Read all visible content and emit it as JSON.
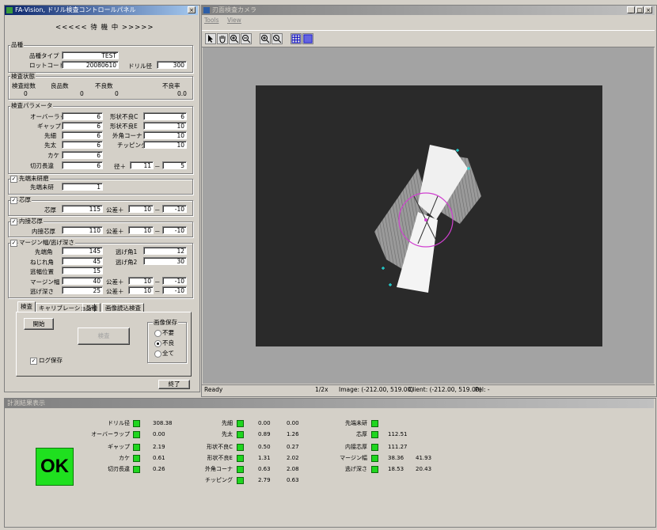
{
  "control_panel": {
    "title": "FA-Vision, ドリル検査コントロールパネル",
    "status": "<<<<< 待 機 中 >>>>>",
    "product": {
      "group": "品種",
      "type_label": "品種タイプ",
      "type_value": "TEST",
      "lot_label": "ロットコード",
      "lot_value": "20080610",
      "diameter_label": "ドリル径",
      "diameter_value": "300"
    },
    "inspection_status": {
      "group": "検査状態",
      "headers": [
        "検査総数",
        "良品数",
        "不良数",
        "不良率"
      ],
      "values": [
        "0",
        "0",
        "0",
        "0.0"
      ]
    },
    "params": {
      "group": "検査パラメータ",
      "left": [
        {
          "label": "オーバーラップ",
          "value": "6"
        },
        {
          "label": "ギャップ",
          "value": "6"
        },
        {
          "label": "先細",
          "value": "6"
        },
        {
          "label": "先太",
          "value": "6"
        },
        {
          "label": "カケ",
          "value": "6"
        },
        {
          "label": "切刃長違",
          "value": "6"
        }
      ],
      "right": [
        {
          "label": "形状不良C",
          "value": "6"
        },
        {
          "label": "形状不良E",
          "value": "10"
        },
        {
          "label": "外角コーナ",
          "value": "10"
        },
        {
          "label": "チッピング",
          "value": "10"
        }
      ],
      "diameter_tol_label": "径＋",
      "diameter_tol_plus": "11",
      "diameter_tol_dash": "－",
      "diameter_tol_minus": "5"
    },
    "tip_unpolished": {
      "group": "先端未研磨",
      "checked": true,
      "label": "先端未研",
      "value": "1"
    },
    "core_thickness": {
      "group": "芯厚",
      "checked": true,
      "label": "芯厚",
      "value": "115",
      "tol_label": "公差＋",
      "tol_plus": "10",
      "tol_dash": "－",
      "tol_minus": "-10"
    },
    "inner_core": {
      "group": "内接芯厚",
      "checked": true,
      "label": "内接芯厚",
      "value": "110",
      "tol_label": "公差＋",
      "tol_plus": "10",
      "tol_dash": "－",
      "tol_minus": "-10"
    },
    "margin": {
      "group": "マージン幅/逃げ深さ",
      "checked": true,
      "tip_angle_label": "先端角",
      "tip_angle": "145",
      "twist_label": "ねじれ角",
      "twist": "45",
      "margin_pos_label": "逃幅位置",
      "margin_pos": "15",
      "margin_width_label": "マージン幅",
      "margin_width": "40",
      "relief_depth_label": "逃げ深さ",
      "relief_depth": "25",
      "relief1_label": "逃げ角1",
      "relief1": "12",
      "relief2_label": "逃げ角2",
      "relief2": "30",
      "tol_label": "公差＋",
      "mw_tol_plus": "10",
      "mw_tol_minus": "-10",
      "rd_tol_plus": "10",
      "rd_tol_minus": "-10",
      "tol_dash": "－"
    },
    "tabs": [
      "検査",
      "キャリブレーション",
      "品種",
      "画像読込検査"
    ],
    "start_button": "開始",
    "inspect_button": "検査",
    "image_save": {
      "group": "画像保存",
      "options": [
        "不要",
        "不良",
        "全て"
      ],
      "selected": "不良"
    },
    "log_save_label": "ログ保存",
    "log_save_checked": true,
    "exit_button": "終了"
  },
  "camera_window": {
    "title": "刃面検査カメラ",
    "menu": [
      "Tools",
      "View"
    ],
    "toolbar_icons": [
      "pointer-icon",
      "hand-icon",
      "zoom-in-icon",
      "zoom-out-icon",
      "zoom-in-2-icon",
      "zoom-fit-icon",
      "grid-icon",
      "grid-dense-icon"
    ],
    "status_ready": "Ready",
    "status_zoom": "1/2x",
    "status_image": "Image: (-212.00, 519.00)",
    "status_client": "Client: (-212.00, 519.00)",
    "status_pel": "Pel: -"
  },
  "results": {
    "title": "計測結果表示",
    "verdict": "OK",
    "verdict_color": "#1fe01f",
    "led_color": "#1fd61f",
    "col1": [
      {
        "label": "ドリル径",
        "v1": "308.38"
      },
      {
        "label": "オーバーラップ",
        "v1": "0.00"
      },
      {
        "label": "ギャップ",
        "v1": "2.19"
      },
      {
        "label": "カケ",
        "v1": "0.61"
      },
      {
        "label": "切刃長違",
        "v1": "0.26"
      }
    ],
    "col2": [
      {
        "label": "先細",
        "v1": "0.00",
        "v2": "0.00"
      },
      {
        "label": "先太",
        "v1": "0.89",
        "v2": "1.26"
      },
      {
        "label": "形状不良C",
        "v1": "0.50",
        "v2": "0.27"
      },
      {
        "label": "形状不良E",
        "v1": "1.31",
        "v2": "2.02"
      },
      {
        "label": "外角コーナ",
        "v1": "0.63",
        "v2": "2.08"
      },
      {
        "label": "チッピング",
        "v1": "2.79",
        "v2": "0.63"
      }
    ],
    "col3": [
      {
        "label": "先端未研",
        "v1": "",
        "v2": ""
      },
      {
        "label": "芯厚",
        "v1": "112.51",
        "v2": ""
      },
      {
        "label": "内接芯厚",
        "v1": "111.27",
        "v2": ""
      },
      {
        "label": "マージン幅",
        "v1": "38.36",
        "v2": "41.93"
      },
      {
        "label": "逃げ深さ",
        "v1": "18.53",
        "v2": "20.43"
      }
    ]
  }
}
